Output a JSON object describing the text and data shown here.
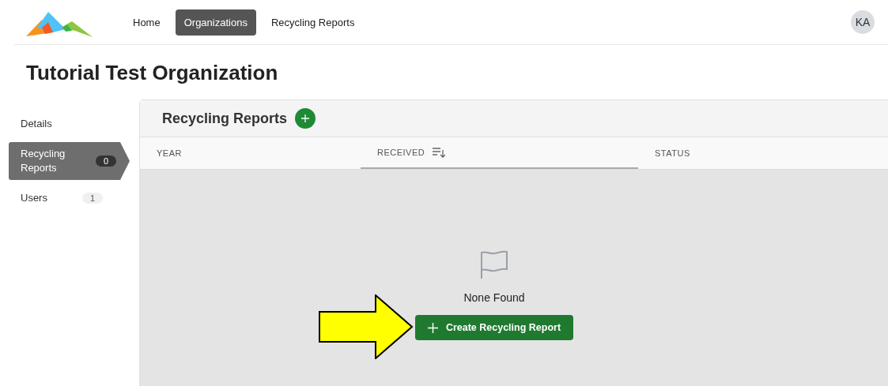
{
  "nav": {
    "items": [
      {
        "label": "Home",
        "selected": false
      },
      {
        "label": "Organizations",
        "selected": true
      },
      {
        "label": "Recycling Reports",
        "selected": false
      }
    ],
    "avatar": "KA"
  },
  "page_title": "Tutorial Test Organization",
  "sidebar": {
    "items": [
      {
        "label": "Details",
        "selected": false
      },
      {
        "label": "Recycling Reports",
        "count": "0",
        "selected": true
      },
      {
        "label": "Users",
        "count": "1",
        "selected": false
      }
    ]
  },
  "panel": {
    "title": "Recycling Reports",
    "columns": [
      {
        "label": "YEAR",
        "sorted": false
      },
      {
        "label": "RECEIVED",
        "sorted": true
      },
      {
        "label": "STATUS",
        "sorted": false
      }
    ],
    "empty_message": "None Found",
    "create_button": "Create Recycling Report"
  }
}
